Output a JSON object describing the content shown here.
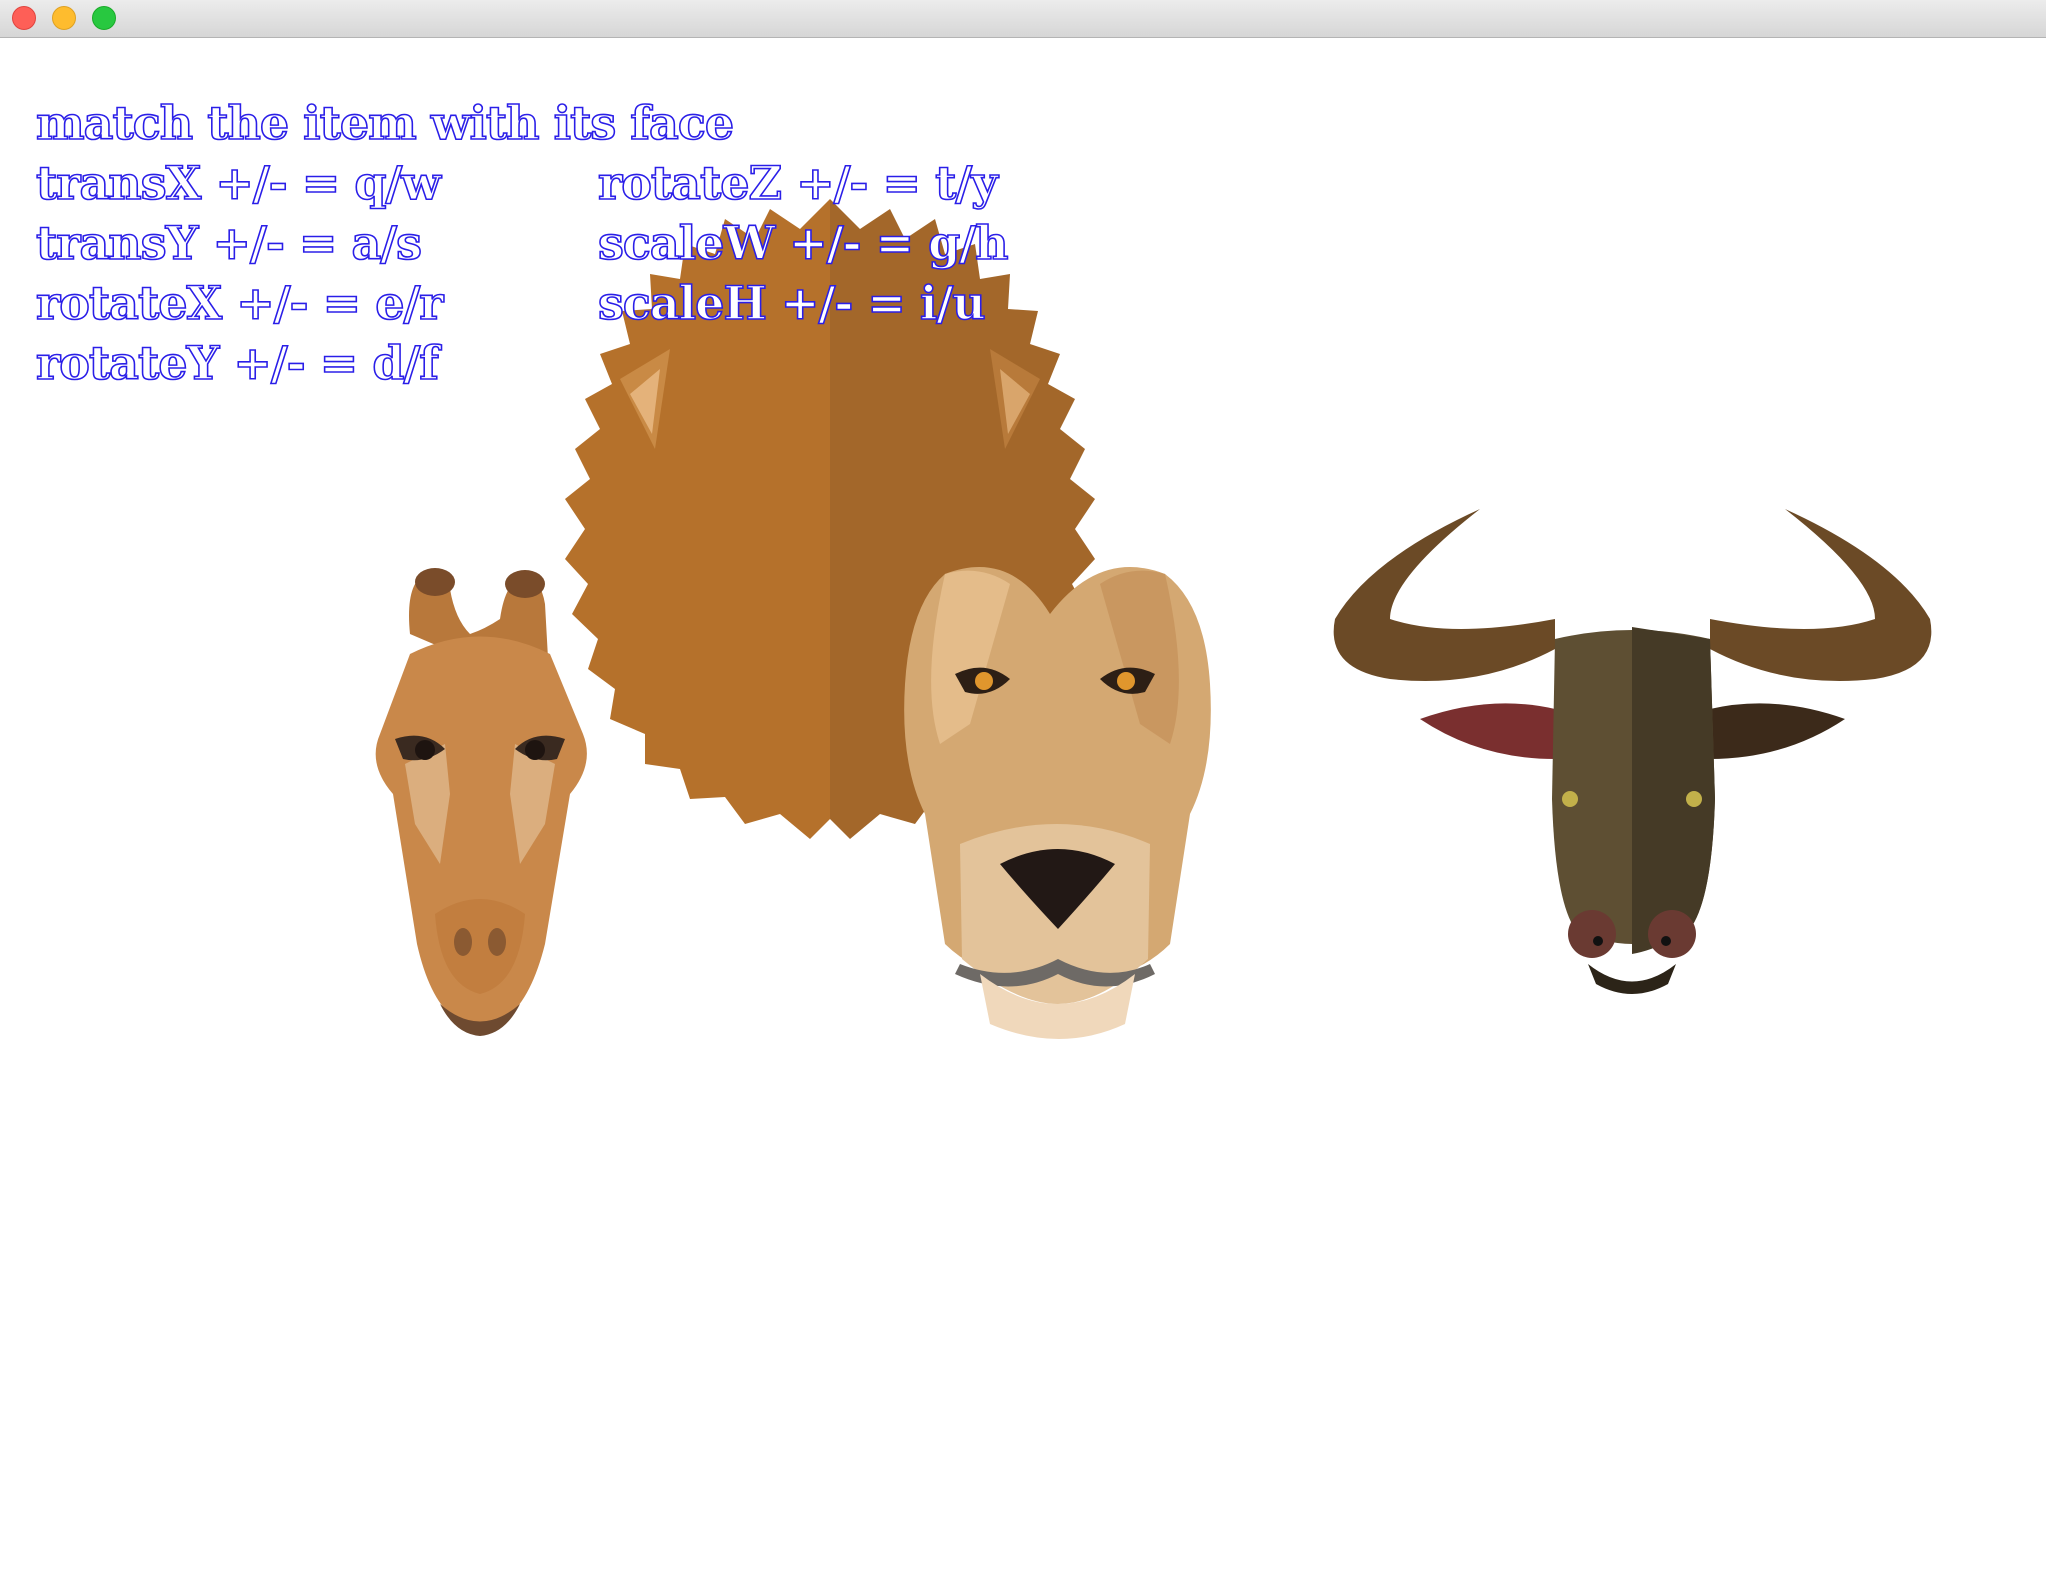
{
  "window": {
    "controls": [
      "close",
      "minimize",
      "zoom"
    ]
  },
  "hud": {
    "title": "match the item with its face",
    "left_controls": [
      "transX +/- = q/w",
      "transY +/- = a/s",
      "rotateX +/- = e/r",
      "rotateY +/- = d/f"
    ],
    "right_controls": [
      "rotateZ +/- = t/y",
      "scaleW +/- = g/h",
      "scaleH +/- = i/u"
    ],
    "text_color": "#2a1ee8"
  },
  "scene": {
    "items": [
      {
        "name": "giraffe face",
        "icon": "giraffe-face-icon"
      },
      {
        "name": "lion mane",
        "icon": "lion-mane-icon"
      },
      {
        "name": "lion face",
        "icon": "lion-face-icon"
      },
      {
        "name": "buffalo face",
        "icon": "buffalo-face-icon"
      }
    ]
  },
  "colors": {
    "mane_light": "#b5712b",
    "mane_dark": "#a3672a",
    "lion_face": "#d4a872",
    "giraffe": "#c9884a",
    "buffalo": "#5e4f33",
    "horn": "#6b4a26"
  }
}
